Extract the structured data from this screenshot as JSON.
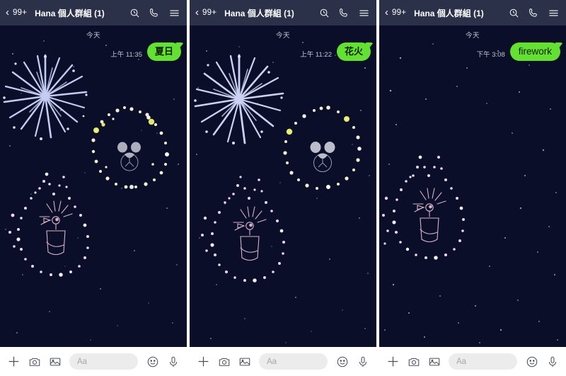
{
  "app": {
    "name": "LINE chat",
    "background_color": "#0a0e28",
    "header_color": "#2b3148",
    "bubble_color": "#63e130"
  },
  "panels": [
    {
      "header": {
        "back_icon": "chevron-left-icon",
        "unread_badge": "99+",
        "title": "Hana 個人群組 (1)",
        "icons": [
          "search-icon",
          "call-icon",
          "menu-icon"
        ]
      },
      "chat": {
        "date_divider": "今天",
        "message": {
          "time": "上午 11:35",
          "text": "夏日",
          "latin": false
        },
        "effect": "summer-fireworks"
      },
      "toolbar": {
        "plus_icon": "plus-icon",
        "camera_icon": "camera-icon",
        "gallery_icon": "gallery-icon",
        "input_placeholder": "Aa",
        "input_value": "",
        "emoji_icon": "smiley-icon",
        "mic_icon": "microphone-icon"
      }
    },
    {
      "header": {
        "back_icon": "chevron-left-icon",
        "unread_badge": "99+",
        "title": "Hana 個人群組 (1)",
        "icons": [
          "search-icon",
          "call-icon",
          "menu-icon"
        ]
      },
      "chat": {
        "date_divider": "今天",
        "message": {
          "time": "上午 11:22",
          "text": "花火",
          "latin": false
        },
        "effect": "hanabi-fireworks"
      },
      "toolbar": {
        "plus_icon": "plus-icon",
        "camera_icon": "camera-icon",
        "gallery_icon": "gallery-icon",
        "input_placeholder": "Aa",
        "input_value": "",
        "emoji_icon": "smiley-icon",
        "mic_icon": "microphone-icon"
      }
    },
    {
      "header": {
        "back_icon": "chevron-left-icon",
        "unread_badge": "99+",
        "title": "Hana 個人群組 (1)",
        "icons": [
          "search-icon",
          "call-icon",
          "menu-icon"
        ]
      },
      "chat": {
        "date_divider": "今天",
        "message": {
          "time": "下午 3:08",
          "text": "firework",
          "latin": true
        },
        "effect": "firework-english"
      },
      "toolbar": {
        "plus_icon": "plus-icon",
        "camera_icon": "camera-icon",
        "gallery_icon": "gallery-icon",
        "input_placeholder": "Aa",
        "input_value": "",
        "emoji_icon": "smiley-icon",
        "mic_icon": "microphone-icon"
      }
    }
  ]
}
